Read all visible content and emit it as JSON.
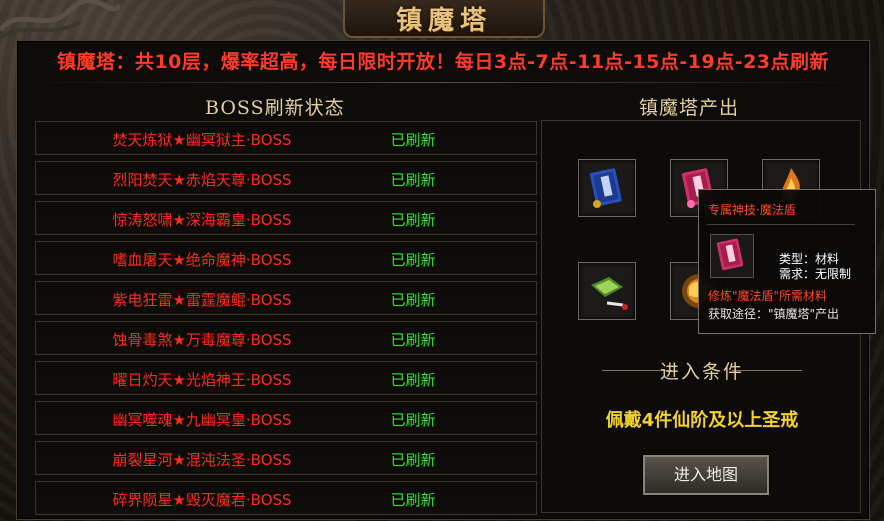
{
  "window": {
    "title": "镇魔塔"
  },
  "notice": "镇魔塔：共10层，爆率超高，每日限时开放！每日3点-7点-11点-15点-19点-23点刷新",
  "boss_section": {
    "title": "BOSS刷新状态",
    "rows": [
      {
        "name": "焚天炼狱★幽冥狱主·BOSS",
        "status": "已刷新"
      },
      {
        "name": "烈阳焚天★赤焰天尊·BOSS",
        "status": "已刷新"
      },
      {
        "name": "惊涛怒啸★深海霸皇·BOSS",
        "status": "已刷新"
      },
      {
        "name": "嗜血屠天★绝命魔神·BOSS",
        "status": "已刷新"
      },
      {
        "name": "紫电狂雷★雷霆魔鲲·BOSS",
        "status": "已刷新"
      },
      {
        "name": "蚀骨毒煞★万毒魔尊·BOSS",
        "status": "已刷新"
      },
      {
        "name": "曜日灼天★光焰神王·BOSS",
        "status": "已刷新"
      },
      {
        "name": "幽冥噬魂★九幽冥皇·BOSS",
        "status": "已刷新"
      },
      {
        "name": "崩裂星河★混沌法圣·BOSS",
        "status": "已刷新"
      },
      {
        "name": "碎界陨星★毁灭魔君·BOSS",
        "status": "已刷新"
      }
    ]
  },
  "output_section": {
    "title": "镇魔塔产出",
    "items": [
      {
        "icon": "blue-skill-book-icon"
      },
      {
        "icon": "red-skill-book-icon"
      },
      {
        "icon": "flame-relic-icon"
      },
      {
        "icon": "green-jade-scroll-icon"
      },
      {
        "icon": "golden-dragon-orb-icon"
      }
    ],
    "condition_title": "进入条件",
    "condition_text": "佩戴4件仙阶及以上圣戒",
    "enter_button": "进入地图"
  },
  "tooltip": {
    "title": "专属神技·魔法盾",
    "type_line": "类型：材料",
    "require_line": "需求：无限制",
    "use_line": "修炼\"魔法盾\"所需材料",
    "source_line": "获取途径：\"镇魔塔\"产出"
  },
  "colors": {
    "notice": "#ff3b2a",
    "boss_name": "#ff2a1e",
    "status": "#34e02e",
    "condition": "#f2d22b",
    "title_gold": "#e8c27a"
  }
}
